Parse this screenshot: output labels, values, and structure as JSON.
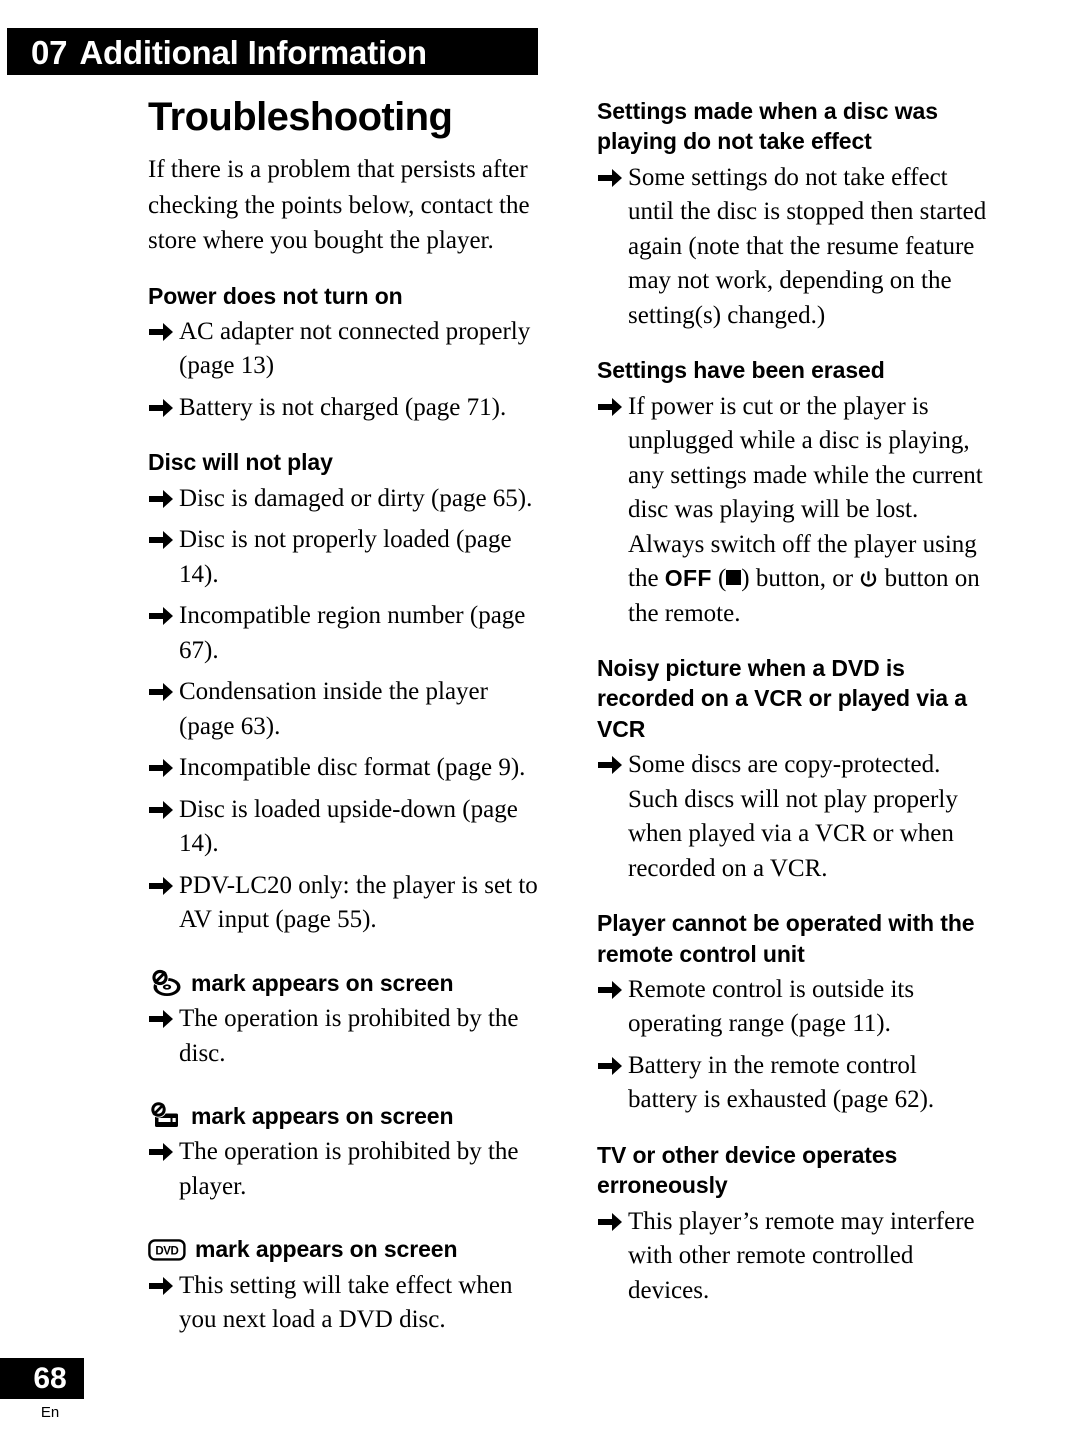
{
  "header": {
    "chapter_number": "07",
    "chapter_title": "Additional Information"
  },
  "footer": {
    "page_number": "68",
    "language_code": "En"
  },
  "left_column": {
    "title": "Troubleshooting",
    "intro": "If there is a problem that persists after checking the points below, contact the store where you bought the player.",
    "sections": [
      {
        "heading": "Power does not turn on",
        "items": [
          "AC adapter not connected properly (page 13)",
          "Battery is not charged (page 71)."
        ]
      },
      {
        "heading": "Disc will not play",
        "items": [
          "Disc is damaged or dirty (page 65).",
          "Disc is not properly loaded (page 14).",
          "Incompatible region number (page 67).",
          "Condensation inside the player (page 63).",
          "Incompatible disc format (page 9).",
          "Disc is loaded upside-down (page 14).",
          "PDV-LC20 only: the player is set to AV input (page 55)."
        ]
      },
      {
        "icon": "prohibited-disc-icon",
        "heading": "mark appears on screen",
        "items": [
          "The operation is prohibited by the disc."
        ]
      },
      {
        "icon": "prohibited-player-icon",
        "heading": "mark appears on screen",
        "items": [
          "The operation is prohibited by the player."
        ]
      },
      {
        "icon": "dvd-badge-icon",
        "heading": "mark appears on screen",
        "items": [
          "This setting will take effect when you next load a DVD disc."
        ]
      }
    ]
  },
  "right_column": {
    "sections": [
      {
        "heading": "Settings made when a disc was playing do not take effect",
        "items": [
          "Some settings do not take effect until the disc is stopped then started again (note that the resume feature may not work, depending on the setting(s) changed.)"
        ]
      },
      {
        "heading": "Settings have been erased",
        "items_rich": [
          {
            "before": "If power is cut or the player is unplugged while a disc is playing, any settings made while the current disc was playing will be lost. Always switch off the player using the ",
            "button_label": "OFF",
            "stop_symbol": "■",
            "middle": " button, or ",
            "power_symbol": "⏻",
            "after": " button on the remote."
          }
        ]
      },
      {
        "heading": "Noisy picture when a DVD is recorded on a VCR or played via a VCR",
        "items": [
          "Some discs are copy-protected. Such discs will not play properly when played via a VCR or when recorded on a VCR."
        ]
      },
      {
        "heading": "Player cannot be operated with the remote control unit",
        "items": [
          "Remote control is outside its operating range (page 11).",
          "Battery in the remote control battery is exhausted (page 62)."
        ]
      },
      {
        "heading": "TV or other device operates erroneously",
        "items": [
          "This player’s remote may interfere with other remote controlled devices."
        ]
      }
    ]
  }
}
